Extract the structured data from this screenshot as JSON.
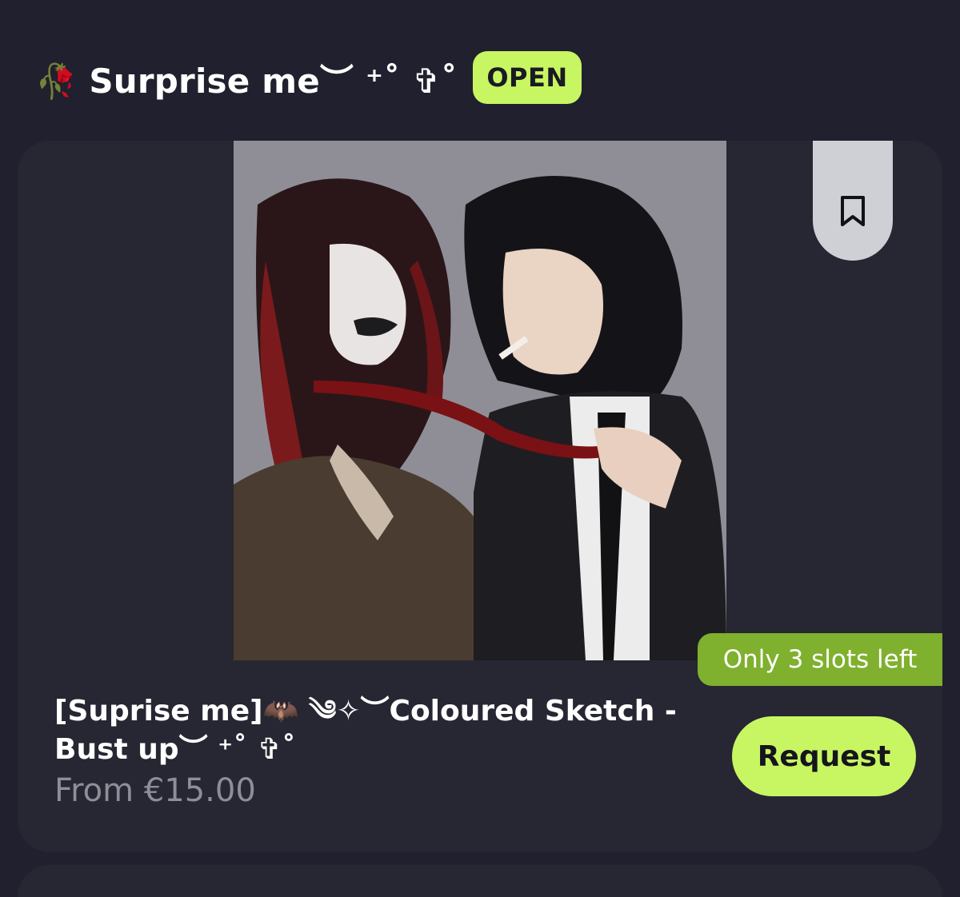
{
  "header": {
    "title": "🥀 Surprise me︶ ⁺˚ ✞˚",
    "status_badge": "OPEN"
  },
  "card": {
    "slots_badge": "Only 3 slots left",
    "item_title": "[Suprise me]🦇 ༄✧︶Coloured Sketch - Bust up︶ ⁺˚ ✞˚",
    "price": "From €15.00",
    "request_label": "Request",
    "bookmark_icon": "bookmark-icon",
    "artwork_icon": "illustration-image"
  },
  "colors": {
    "background": "#20202e",
    "card": "#272733",
    "accent": "#c8f562",
    "slots_badge": "#7fb02e",
    "price_text": "#8e8e98"
  }
}
